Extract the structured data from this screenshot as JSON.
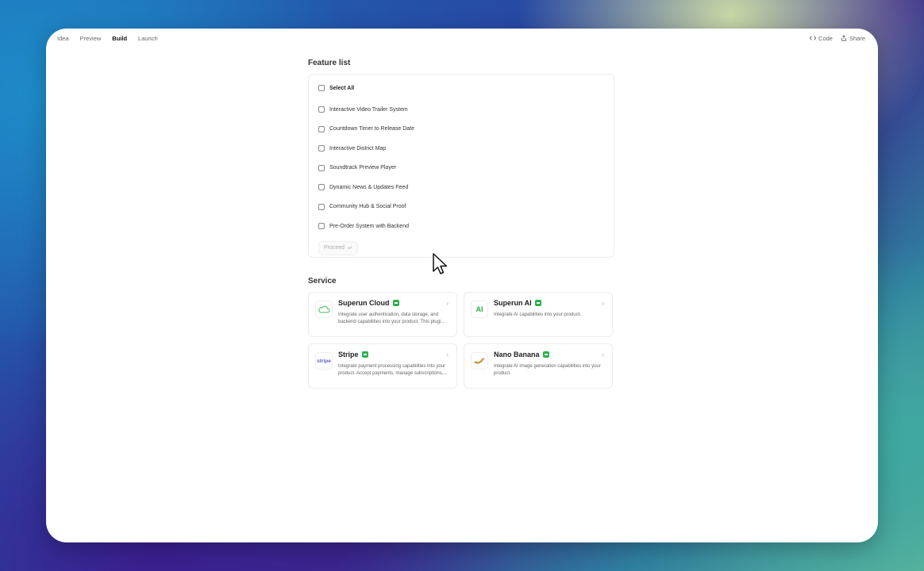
{
  "topbar": {
    "tabs": [
      {
        "label": "Idea"
      },
      {
        "label": "Preview"
      },
      {
        "label": "Build"
      },
      {
        "label": "Launch"
      }
    ],
    "active_tab": "Build",
    "code_label": "Code",
    "share_label": "Share"
  },
  "features": {
    "title": "Feature list",
    "select_all": "Select All",
    "items": [
      {
        "label": "Interactive Video Trailer System",
        "checked": false
      },
      {
        "label": "Countdown Timer to Release Date",
        "checked": false
      },
      {
        "label": "Interactive District Map",
        "checked": false
      },
      {
        "label": "Soundtrack Preview Player",
        "checked": false
      },
      {
        "label": "Dynamic News & Updates Feed",
        "checked": false
      },
      {
        "label": "Community Hub & Social Proof",
        "checked": false
      },
      {
        "label": "Pre-Order System with Backend",
        "checked": false
      }
    ],
    "proceed_label": "Proceed",
    "proceed_glyph": "↵"
  },
  "service": {
    "title": "Service",
    "cards": [
      {
        "name": "Superun Cloud",
        "desc": "Integrate user authentication, data storage, and backend capabilities into your product. This plugi...",
        "icon": "cloud-icon"
      },
      {
        "name": "Superun AI",
        "desc": "Integrate AI capabilities into your product.",
        "icon": "ai-icon"
      },
      {
        "name": "Stripe",
        "desc": "Integrate payment processing capabilities into your product. Accept payments, manage subscriptions,...",
        "icon": "stripe-icon"
      },
      {
        "name": "Nano Banana",
        "desc": "Integrate AI image generation capabilities into your product.",
        "icon": "banana-icon"
      }
    ],
    "logo_texts": {
      "ai": "AI",
      "stripe": "stripe"
    }
  },
  "colors": {
    "badge": "#28b24b",
    "accent": "#111111"
  }
}
